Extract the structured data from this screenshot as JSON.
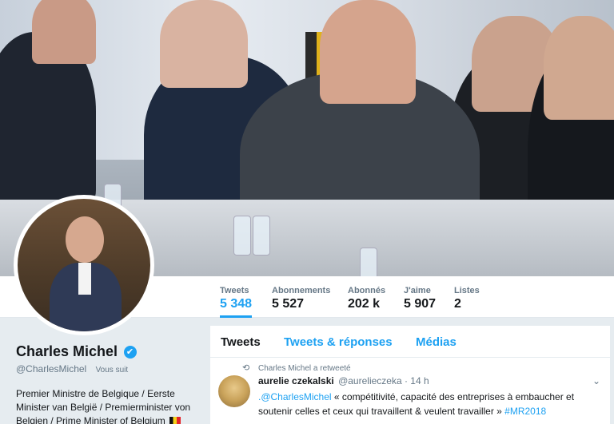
{
  "nav": {
    "items": [
      {
        "label": "Tweets",
        "value": "5 348"
      },
      {
        "label": "Abonnements",
        "value": "5 527"
      },
      {
        "label": "Abonnés",
        "value": "202 k"
      },
      {
        "label": "J'aime",
        "value": "5 907"
      },
      {
        "label": "Listes",
        "value": "2"
      }
    ]
  },
  "profile": {
    "name": "Charles Michel",
    "verified_icon": "✔",
    "handle": "@CharlesMichel",
    "follows_you": "Vous suit",
    "bio": "Premier Ministre de Belgique / Eerste Minister van België / Premierminister von Belgien / Prime Minister of Belgium"
  },
  "timeline": {
    "tabs": [
      "Tweets",
      "Tweets & réponses",
      "Médias"
    ],
    "retweet_label": "Charles Michel a retweeté",
    "retweet_icon": "⟲",
    "tweet": {
      "name": "aurelie czekalski",
      "handle": "@aurelieczeka · 14 h",
      "mention": ".@CharlesMichel",
      "text": " « compétitivité, capacité des entreprises à embaucher et soutenir celles et ceux qui travaillent & veulent travailler » ",
      "hashtag": "#MR2018",
      "menu_icon": "⌄"
    }
  },
  "colors": {
    "accent": "#1da1f2",
    "background": "#e6ecf0"
  }
}
